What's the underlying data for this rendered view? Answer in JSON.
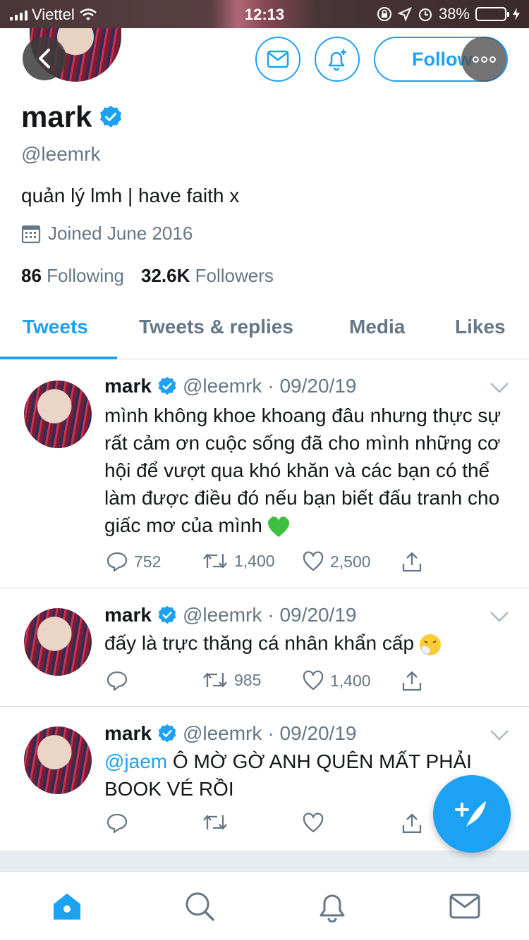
{
  "status_bar": {
    "carrier": "Viettel",
    "time": "12:13",
    "battery_percent": "38%",
    "battery_level": 0.38
  },
  "header": {
    "follow_label": "Follow"
  },
  "profile": {
    "name": "mark",
    "handle": "@leemrk",
    "bio": "quản lý lmh | have faith x",
    "joined": "Joined June 2016",
    "following_count": "86",
    "following_label": "Following",
    "followers_count": "32.6K",
    "followers_label": "Followers"
  },
  "tabs": [
    {
      "label": "Tweets",
      "active": true
    },
    {
      "label": "Tweets & replies",
      "active": false
    },
    {
      "label": "Media",
      "active": false
    },
    {
      "label": "Likes",
      "active": false
    }
  ],
  "tweets": [
    {
      "name": "mark",
      "handle": "@leemrk",
      "date": "· 09/20/19",
      "text": "mình không khoe khoang đâu nhưng thực sự rất cảm ơn cuộc sống đã cho mình những cơ hội để vượt qua khó khăn và các bạn có thể làm được điều đó nếu bạn biết đấu tranh cho giấc mơ của mình",
      "emoji": "green-heart",
      "replies": "752",
      "retweets": "1,400",
      "likes": "2,500"
    },
    {
      "name": "mark",
      "handle": "@leemrk",
      "date": "· 09/20/19",
      "text": "đấy là trực thăng cá nhân khẩn cấp",
      "emoji": "sneezing-face",
      "replies": "",
      "retweets": "985",
      "likes": "1,400"
    },
    {
      "name": "mark",
      "handle": "@leemrk",
      "date": "· 09/20/19",
      "mention": "@jaem",
      "text": " Ô MỜ GỜ ANH QUÊN MẤT PHẢI BOOK VÉ RỒI",
      "replies": "",
      "retweets": "",
      "likes": ""
    }
  ],
  "colors": {
    "accent": "#1da1f2",
    "secondary_text": "#657786",
    "divider": "#d6dde3"
  },
  "icons": [
    "back-arrow-icon",
    "mail-icon",
    "bell-plus-icon",
    "more-icon",
    "verified-badge-icon",
    "calendar-icon",
    "chevron-down-icon",
    "reply-icon",
    "retweet-icon",
    "like-icon",
    "share-icon",
    "compose-tweet-icon",
    "home-icon",
    "search-icon",
    "notifications-icon",
    "messages-icon"
  ]
}
